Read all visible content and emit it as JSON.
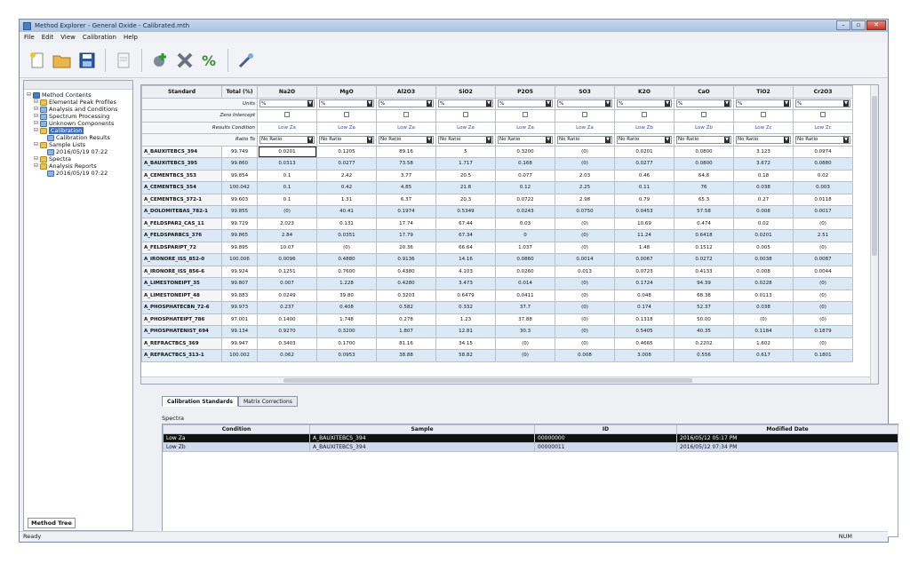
{
  "window": {
    "title": "Method Explorer - General Oxide - Calibrated.mth"
  },
  "menu": [
    "File",
    "Edit",
    "View",
    "Calibration",
    "Help"
  ],
  "tree": [
    {
      "label": "Method Contents",
      "icon": "method-root-icon",
      "indent": 0
    },
    {
      "label": "Elemental Peak Profiles",
      "icon": "folder-icon",
      "indent": 1
    },
    {
      "label": "Analysis and Conditions",
      "icon": "document-icon",
      "indent": 1
    },
    {
      "label": "Spectrum Processing",
      "icon": "document-icon",
      "indent": 1
    },
    {
      "label": "Unknown Components",
      "icon": "document-icon",
      "indent": 1
    },
    {
      "label": "Calibration",
      "icon": "folder-icon",
      "indent": 1,
      "selected": true
    },
    {
      "label": "Calibration Results",
      "icon": "document-icon",
      "indent": 2
    },
    {
      "label": "Sample Lists",
      "icon": "folder-icon",
      "indent": 1
    },
    {
      "label": "2016/05/19 07:22",
      "icon": "document-icon",
      "indent": 2
    },
    {
      "label": "Spectra",
      "icon": "folder-icon",
      "indent": 1
    },
    {
      "label": "Analysis Reports",
      "icon": "folder-icon",
      "indent": 1
    },
    {
      "label": "2016/05/19 07:22",
      "icon": "document-icon",
      "indent": 2
    }
  ],
  "left_tab": "Method Tree",
  "grid": {
    "header_standard": "Standard",
    "header_total": "Total (%)",
    "columns": [
      "Na2O",
      "MgO",
      "Al2O3",
      "SiO2",
      "P2O5",
      "SO3",
      "K2O",
      "CaO",
      "TiO2",
      "Cr2O3"
    ],
    "meta_rows": [
      {
        "label": "Units",
        "kind": "dropdown",
        "value": "%"
      },
      {
        "label": "Zero Intercept",
        "kind": "checkbox",
        "value": ""
      },
      {
        "label": "Results Condition",
        "kind": "link",
        "values": [
          "Low Za",
          "Low Za",
          "Low Za",
          "Low Za",
          "Low Za",
          "Low Za",
          "Low Zb",
          "Low Zb",
          "Low Zc",
          "Low Zc"
        ]
      },
      {
        "label": "Ratio To",
        "kind": "dropdown",
        "value": "No Ratio"
      }
    ],
    "rows": [
      {
        "name": "A_BAUXITEBCS_394",
        "total": "99.749",
        "values": [
          "0.0201",
          "0.1205",
          "89.16",
          "5",
          "0.3200",
          "(0)",
          "0.0201",
          "0.0800",
          "3.123",
          "0.0974"
        ]
      },
      {
        "name": "A_BAUXITEBCS_395",
        "total": "99.860",
        "values": [
          "0.0313",
          "0.0277",
          "73.58",
          "1.717",
          "0.168",
          "(0)",
          "0.0277",
          "0.0800",
          "3.672",
          "0.0880"
        ]
      },
      {
        "name": "A_CEMENTBCS_353",
        "total": "99.854",
        "values": [
          "0.1",
          "2.42",
          "3.77",
          "20.5",
          "0.077",
          "2.03",
          "0.46",
          "64.8",
          "0.18",
          "0.02"
        ]
      },
      {
        "name": "A_CEMENTBCS_354",
        "total": "100.042",
        "values": [
          "0.1",
          "0.42",
          "4.85",
          "21.8",
          "0.12",
          "2.25",
          "0.11",
          "76",
          "0.038",
          "0.003"
        ]
      },
      {
        "name": "A_CEMENTBCS_372-1",
        "total": "99.603",
        "values": [
          "0.1",
          "1.31",
          "6.37",
          "20.3",
          "0.0722",
          "2.98",
          "0.79",
          "65.3",
          "0.27",
          "0.0118"
        ]
      },
      {
        "name": "A_DOLOMITEBAS_782-1",
        "total": "99.855",
        "values": [
          "(0)",
          "40.41",
          "0.1974",
          "0.5349",
          "0.0243",
          "0.0750",
          "0.0453",
          "57.58",
          "0.008",
          "0.0017"
        ]
      },
      {
        "name": "A_FELDSPAR2_CAS_11",
        "total": "99.729",
        "values": [
          "2.023",
          "0.131",
          "17.74",
          "67.44",
          "0.03",
          "(0)",
          "10.69",
          "0.474",
          "0.02",
          "(0)"
        ]
      },
      {
        "name": "A_FELDSPARBCS_376",
        "total": "99.865",
        "values": [
          "2.84",
          "0.0351",
          "17.79",
          "67.34",
          "0",
          "(0)",
          "11.24",
          "0.6418",
          "0.0201",
          "2.51"
        ]
      },
      {
        "name": "A_FELDSPARIPT_72",
        "total": "99.895",
        "values": [
          "10.07",
          "(0)",
          "20.36",
          "66.64",
          "1.037",
          "(0)",
          "1.48",
          "0.1512",
          "0.005",
          "(0)"
        ]
      },
      {
        "name": "A_IRONORE_ISS_852-0",
        "total": "100.006",
        "values": [
          "0.0096",
          "0.4880",
          "0.9136",
          "14.16",
          "0.0860",
          "0.0014",
          "0.0067",
          "0.0272",
          "0.0038",
          "0.0087"
        ]
      },
      {
        "name": "A_IRONORE_ISS_856-6",
        "total": "99.924",
        "values": [
          "0.1251",
          "0.7600",
          "0.4380",
          "4.103",
          "0.0260",
          "0.013",
          "0.0723",
          "0.4133",
          "0.008",
          "0.0044"
        ]
      },
      {
        "name": "A_LIMESTONEIPT_35",
        "total": "99.807",
        "values": [
          "0.007",
          "1.228",
          "0.4280",
          "3.473",
          "0.014",
          "(0)",
          "0.1724",
          "94.39",
          "0.0228",
          "(0)"
        ]
      },
      {
        "name": "A_LIMESTONEIPT_48",
        "total": "99.883",
        "values": [
          "0.0249",
          "39.80",
          "0.3203",
          "0.6479",
          "0.0411",
          "(0)",
          "0.048",
          "68.38",
          "0.0113",
          "(0)"
        ]
      },
      {
        "name": "A_PHOSPHATECBN_72-6",
        "total": "99.973",
        "values": [
          "0.237",
          "0.408",
          "0.582",
          "0.332",
          "37.7",
          "(0)",
          "0.174",
          "52.37",
          "0.038",
          "(0)"
        ]
      },
      {
        "name": "A_PHOSPHATEIPT_786",
        "total": "97.001",
        "values": [
          "0.1400",
          "1.748",
          "0.278",
          "1.23",
          "37.88",
          "(0)",
          "0.1318",
          "50.00",
          "(0)",
          "(0)"
        ]
      },
      {
        "name": "A_PHOSPHATENIST_694",
        "total": "99.134",
        "values": [
          "0.9270",
          "0.3200",
          "1.807",
          "12.81",
          "30.3",
          "(0)",
          "0.5405",
          "40.35",
          "0.1184",
          "0.1879"
        ]
      },
      {
        "name": "A_REFRACTBCS_369",
        "total": "99.947",
        "values": [
          "0.3403",
          "0.1700",
          "81.16",
          "34.15",
          "(0)",
          "(0)",
          "0.4665",
          "0.2202",
          "1.602",
          "(0)"
        ]
      },
      {
        "name": "A_REFRACTBCS_313-1",
        "total": "100.002",
        "values": [
          "0.062",
          "0.0953",
          "38.88",
          "58.82",
          "(0)",
          "0.008",
          "3.008",
          "0.556",
          "0.617",
          "0.1801"
        ]
      }
    ]
  },
  "tabs": [
    "Calibration Standards",
    "Matrix Corrections"
  ],
  "spectra": {
    "label": "Spectra",
    "headers": [
      "Condition",
      "Sample",
      "ID",
      "Modified Date"
    ],
    "rows": [
      {
        "condition": "Low Za",
        "sample": "A_BAUXITEBCS_394",
        "id": "00000000",
        "date": "2016/05/12 05:17 PM"
      },
      {
        "condition": "Low Zb",
        "sample": "A_BAUXITEBCS_394",
        "id": "00000011",
        "date": "2016/05/12 07:34 PM"
      }
    ]
  },
  "status": {
    "left": "Ready",
    "right": "NUM"
  }
}
